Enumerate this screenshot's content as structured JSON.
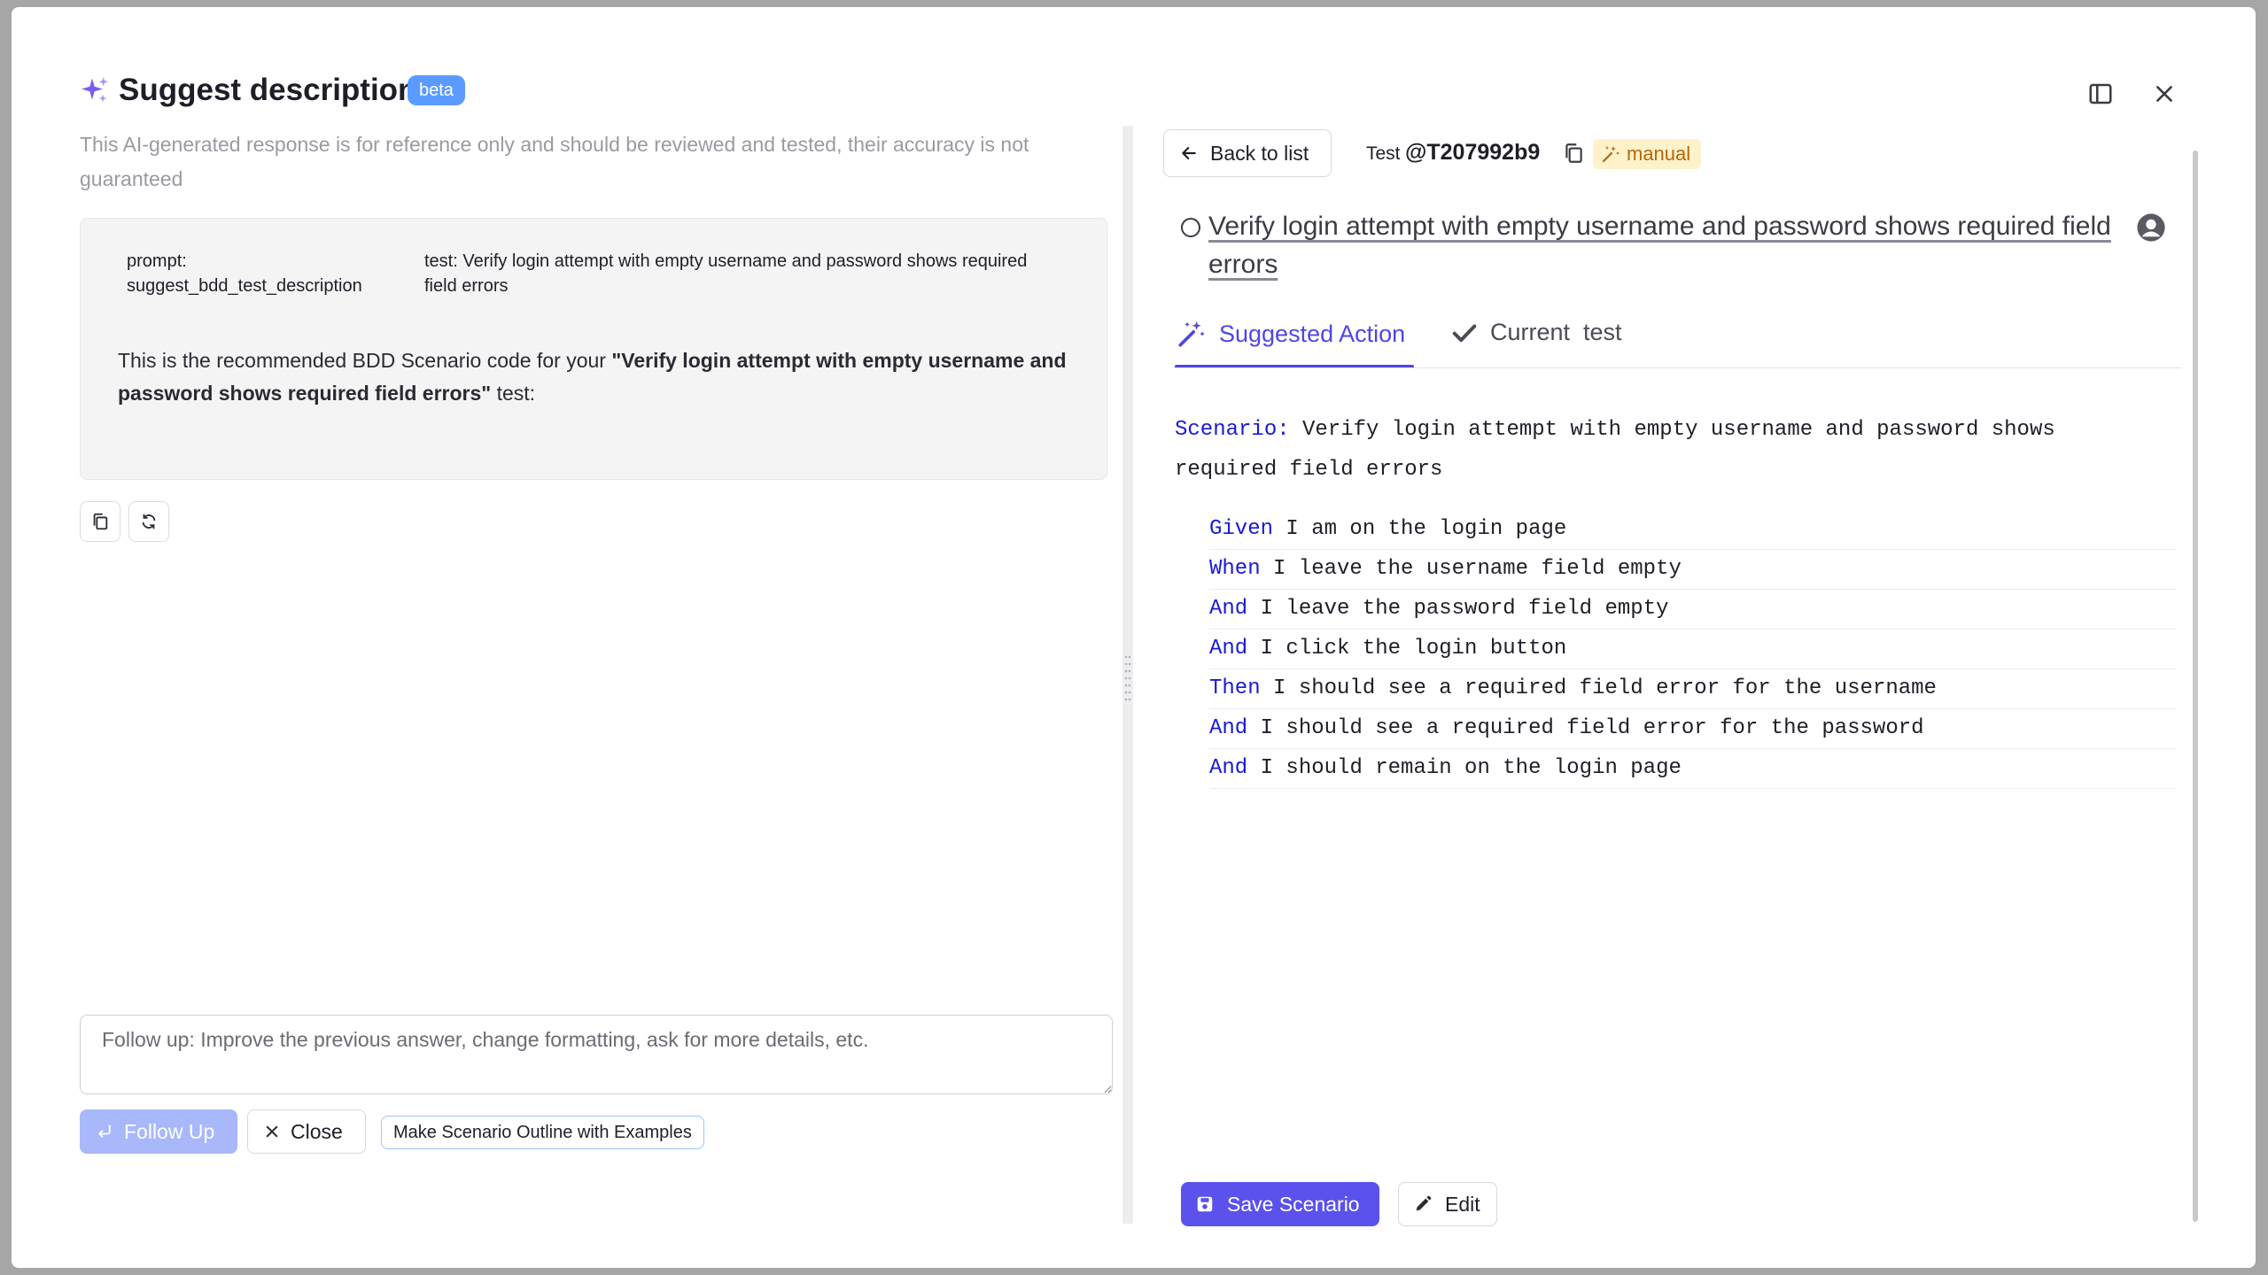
{
  "header": {
    "title": "Suggest description",
    "badge": "beta"
  },
  "left": {
    "disclaimer": "This AI-generated response is for reference only and should be reviewed and tested, their accuracy is not guaranteed",
    "prompt_key": "prompt: suggest_bdd_test_description",
    "prompt_value": "test: Verify login attempt with empty username and password shows required field errors",
    "intro_prefix": "This is the recommended BDD Scenario code for your ",
    "intro_bold": "\"Verify login attempt with empty username and password shows required field errors\"",
    "intro_suffix": " test:",
    "followup_placeholder": "Follow up: Improve the previous answer, change formatting, ask for more details, etc.",
    "follow_up_label": "Follow Up",
    "close_label": "Close",
    "chip_label": "Make Scenario Outline with Examples"
  },
  "right": {
    "back_label": "Back to list",
    "test_label": "Test",
    "test_id": "@T207992b9",
    "badge_manual": "manual",
    "test_title": "Verify login attempt with empty username and password shows required field errors",
    "tabs": [
      {
        "label": "Suggested Action",
        "active": true
      },
      {
        "label": "Current  test",
        "active": false
      }
    ],
    "scenario_keyword": "Scenario:",
    "scenario_text": " Verify login attempt with empty username and password shows required field errors",
    "steps": [
      {
        "kw": "Given",
        "text": " I am on the login page"
      },
      {
        "kw": "When",
        "text": " I leave the username field empty"
      },
      {
        "kw": "And",
        "text": " I leave the password field empty"
      },
      {
        "kw": "And",
        "text": " I click the login button"
      },
      {
        "kw": "Then",
        "text": " I should see a required field error for the username"
      },
      {
        "kw": "And",
        "text": " I should see a required field error for the password"
      },
      {
        "kw": "And",
        "text": " I should remain on the login page"
      }
    ],
    "save_label": "Save Scenario",
    "edit_label": "Edit"
  },
  "colors": {
    "accent": "#4f46e5",
    "badge_blue": "#5b9bff",
    "manual_bg": "#fdf2c9",
    "manual_text": "#b6660a",
    "keyword": "#1a1ad6"
  }
}
